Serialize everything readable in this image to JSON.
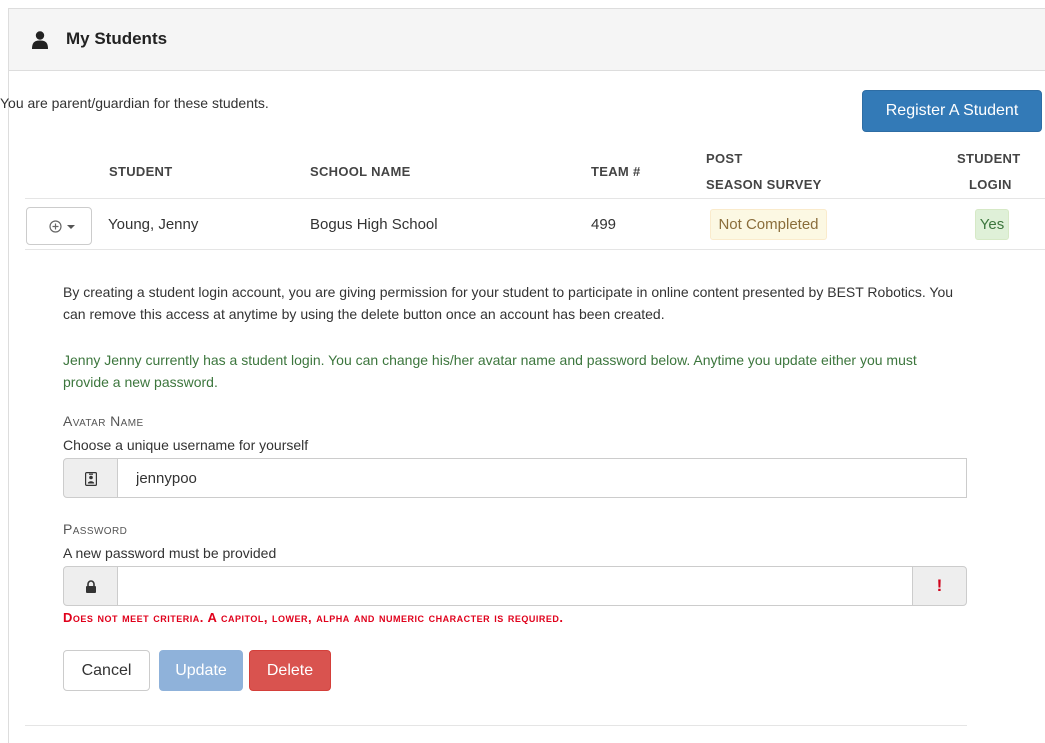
{
  "panel": {
    "title": "My Students",
    "title_icon": "user-icon"
  },
  "intro_text": "You are parent/guardian for these students.",
  "register_button": "Register A Student",
  "table": {
    "headers": {
      "student": "STUDENT",
      "school": "SCHOOL NAME",
      "team": "TEAM #",
      "survey_line1": "POST",
      "survey_line2": "SEASON SURVEY",
      "login_line1": "STUDENT",
      "login_line2": "LOGIN"
    },
    "rows": [
      {
        "action_icon": "circle-plus-icon",
        "student": "Young, Jenny",
        "school": "Bogus High School",
        "team": "499",
        "survey_status": "Not Completed",
        "student_login": "Yes"
      }
    ]
  },
  "login_form": {
    "info_text": "By creating a student login account, you are giving permission for your student to participate in online content presented by BEST Robotics. You can remove this access at anytime by using the delete button once an account has been created.",
    "status_text": "Jenny Jenny currently has a student login. You can change his/her avatar name and password below. Anytime you update either you must provide a new password.",
    "avatar": {
      "label": "Avatar Name",
      "help": "Choose a unique username for yourself",
      "value": "jennypoo",
      "icon": "id-badge-icon"
    },
    "password": {
      "label": "Password",
      "help": "A new password must be provided",
      "value": "",
      "icon": "lock-icon",
      "status_icon": "!",
      "error": "Does not meet criteria. A capitol, lower, alpha and numeric character is required."
    },
    "buttons": {
      "cancel": "Cancel",
      "update": "Update",
      "delete": "Delete"
    }
  },
  "colors": {
    "primary": "#337ab7",
    "danger": "#d9534f",
    "success_text": "#3c763d",
    "warning_bg": "#fcf8e3",
    "error_text": "#e0001b"
  }
}
